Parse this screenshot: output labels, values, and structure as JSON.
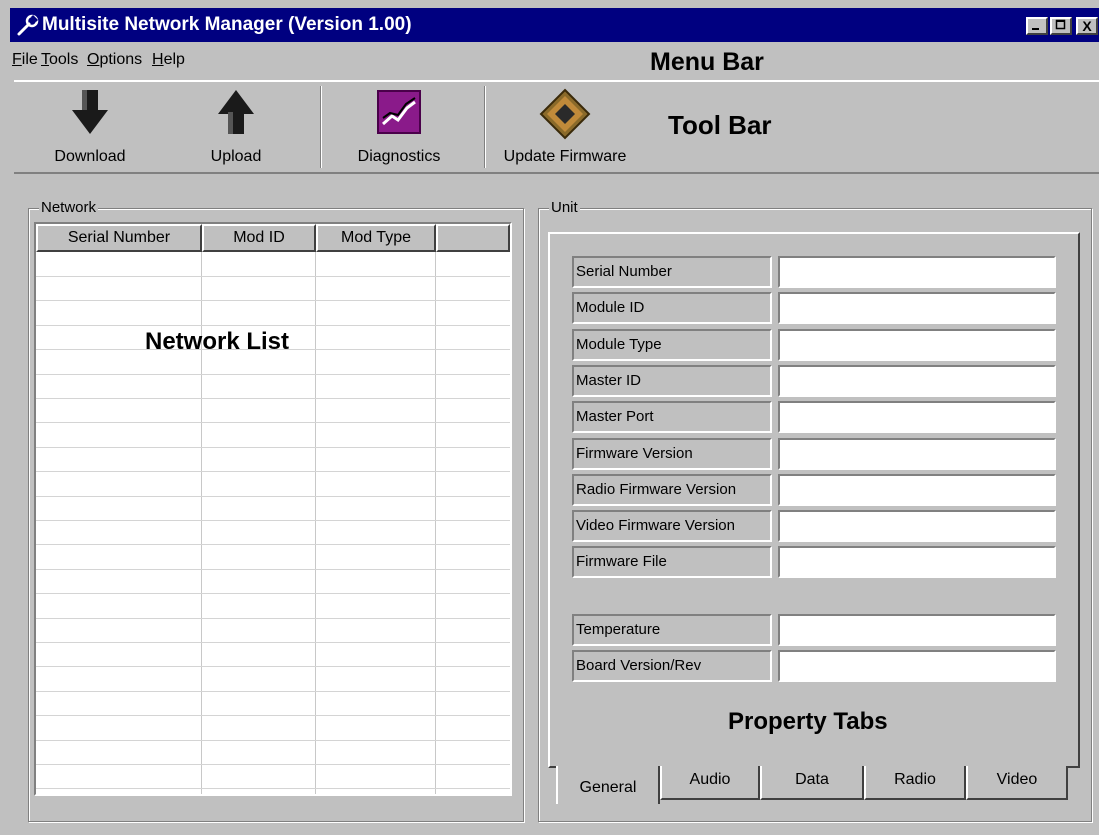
{
  "window": {
    "title": "Multisite Network Manager (Version 1.00)",
    "controls": [
      "minimize",
      "maximize",
      "close"
    ],
    "close_glyph": "X"
  },
  "menu": [
    "File",
    "Tools",
    "Options",
    "Help"
  ],
  "annotations": {
    "menu_bar": "Menu Bar",
    "tool_bar": "Tool Bar",
    "network_list": "Network List",
    "property_tabs": "Property Tabs"
  },
  "toolbar": {
    "buttons": [
      {
        "label": "Download",
        "icon": "download-arrow-icon"
      },
      {
        "label": "Upload",
        "icon": "upload-arrow-icon"
      },
      {
        "label": "Diagnostics",
        "icon": "diagnostics-chart-icon"
      },
      {
        "label": "Update Firmware",
        "icon": "chip-icon"
      }
    ]
  },
  "network": {
    "group_label": "Network",
    "columns": [
      "Serial Number",
      "Mod ID",
      "Mod Type",
      ""
    ],
    "rows": []
  },
  "unit": {
    "group_label": "Unit",
    "fields": [
      {
        "label": "Serial Number",
        "value": ""
      },
      {
        "label": "Module ID",
        "value": ""
      },
      {
        "label": "Module Type",
        "value": ""
      },
      {
        "label": "Master ID",
        "value": ""
      },
      {
        "label": "Master Port",
        "value": ""
      },
      {
        "label": "Firmware Version",
        "value": ""
      },
      {
        "label": "Radio Firmware Version",
        "value": ""
      },
      {
        "label": "Video Firmware Version",
        "value": ""
      },
      {
        "label": "Firmware File",
        "value": ""
      }
    ],
    "extra_fields": [
      {
        "label": "Temperature",
        "value": ""
      },
      {
        "label": "Board Version/Rev",
        "value": ""
      }
    ],
    "tabs": [
      "General",
      "Audio",
      "Data",
      "Radio",
      "Video"
    ],
    "active_tab": "General"
  },
  "colors": {
    "titlebar": "#000080",
    "face": "#c0c0c0",
    "diagnostics_icon": "#8a1a8a"
  }
}
